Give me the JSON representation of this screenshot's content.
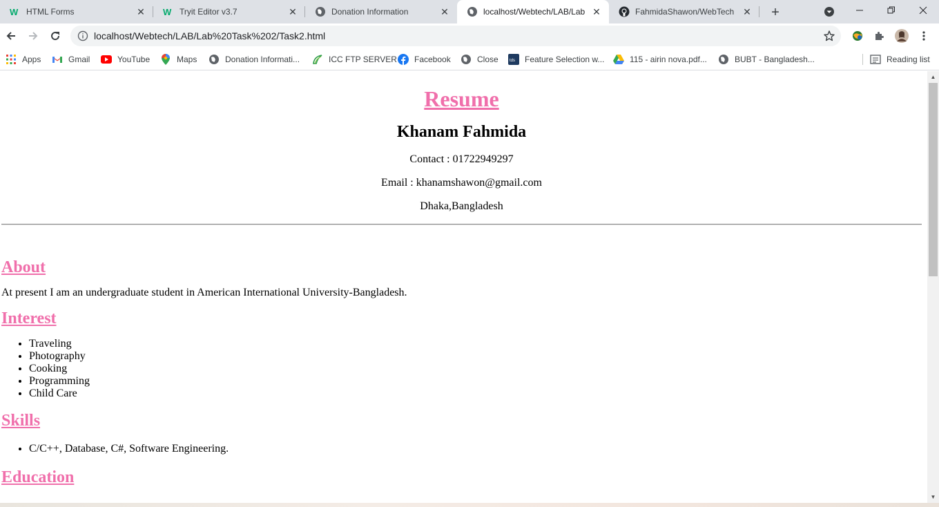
{
  "tabs": [
    {
      "title": "HTML Forms"
    },
    {
      "title": "Tryit Editor v3.7"
    },
    {
      "title": "Donation Information"
    },
    {
      "title": "localhost/Webtech/LAB/Lab"
    },
    {
      "title": "FahmidaShawon/WebTech"
    }
  ],
  "address_bar": {
    "url": "localhost/Webtech/LAB/Lab%20Task%202/Task2.html"
  },
  "bookmarks": [
    {
      "label": "Apps"
    },
    {
      "label": "Gmail"
    },
    {
      "label": "YouTube"
    },
    {
      "label": "Maps"
    },
    {
      "label": "Donation Informati..."
    },
    {
      "label": "ICC FTP SERVER"
    },
    {
      "label": "Facebook"
    },
    {
      "label": "Close"
    },
    {
      "label": "Feature Selection w..."
    },
    {
      "label": "115 - airin nova.pdf..."
    },
    {
      "label": "BUBT - Bangladesh..."
    }
  ],
  "reading_list": {
    "label": "Reading list"
  },
  "page": {
    "title": "Resume",
    "name": "Khanam Fahmida",
    "contact": "Contact : 01722949297",
    "email": "Email : khanamshawon@gmail.com",
    "location": "Dhaka,Bangladesh",
    "sections": {
      "about": {
        "heading": "About",
        "text": "At present I am an undergraduate student in American International University-Bangladesh."
      },
      "interest": {
        "heading": "Interest",
        "items": [
          "Traveling",
          "Photography",
          "Cooking",
          "Programming",
          "Child Care"
        ]
      },
      "skills": {
        "heading": "Skills",
        "items": [
          "C/C++, Database, C#, Software Engineering."
        ]
      },
      "education": {
        "heading": "Education"
      }
    }
  },
  "colors": {
    "heading_pink": "#f06fab",
    "tabstrip": "#dee1e6"
  }
}
